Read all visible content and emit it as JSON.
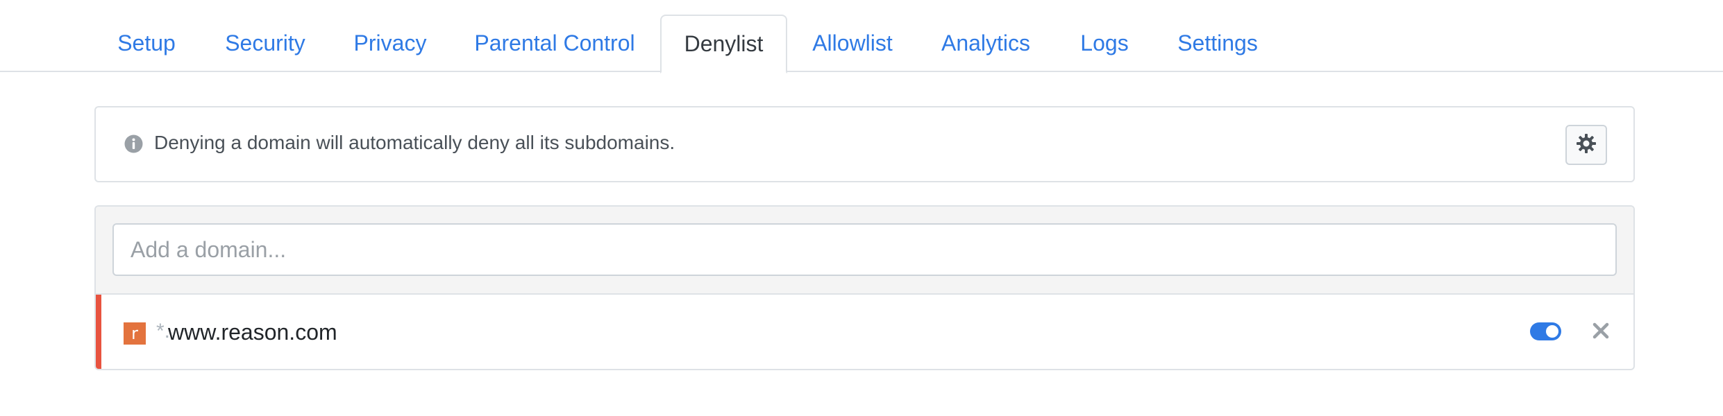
{
  "tabs": [
    {
      "label": "Setup",
      "active": false
    },
    {
      "label": "Security",
      "active": false
    },
    {
      "label": "Privacy",
      "active": false
    },
    {
      "label": "Parental Control",
      "active": false
    },
    {
      "label": "Denylist",
      "active": true
    },
    {
      "label": "Allowlist",
      "active": false
    },
    {
      "label": "Analytics",
      "active": false
    },
    {
      "label": "Logs",
      "active": false
    },
    {
      "label": "Settings",
      "active": false
    }
  ],
  "info": {
    "icon": "info-circle-icon",
    "text": "Denying a domain will automatically deny all its subdomains.",
    "settings_icon": "gear-icon"
  },
  "add_domain": {
    "placeholder": "Add a domain...",
    "value": ""
  },
  "domains": [
    {
      "favicon_letter": "r",
      "wildcard": "*.",
      "domain": "www.reason.com",
      "enabled": true
    }
  ],
  "colors": {
    "accent": "#2f7ae5",
    "deny_bar": "#e8533f",
    "favicon_bg": "#e3733e",
    "active_tab_text": "#343a40"
  }
}
